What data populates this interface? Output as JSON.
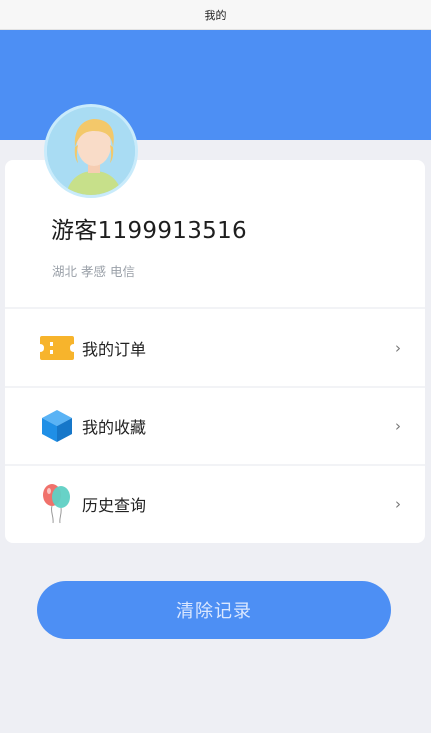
{
  "topbar": {
    "title": "我的"
  },
  "profile": {
    "username": "游客1199913516",
    "location": "湖北 孝感 电信"
  },
  "menu": [
    {
      "label": "我的订单",
      "icon": "ticket-icon",
      "arrow": "›"
    },
    {
      "label": "我的收藏",
      "icon": "cube-icon",
      "arrow": "›"
    },
    {
      "label": "历史查询",
      "icon": "balloons-icon",
      "arrow": "›"
    }
  ],
  "actions": {
    "clear_label": "清除记录"
  },
  "colors": {
    "accent": "#4d8ff4",
    "background": "#eeeff4",
    "ticket": "#f7b42c",
    "cube": "#1f8fe6"
  }
}
